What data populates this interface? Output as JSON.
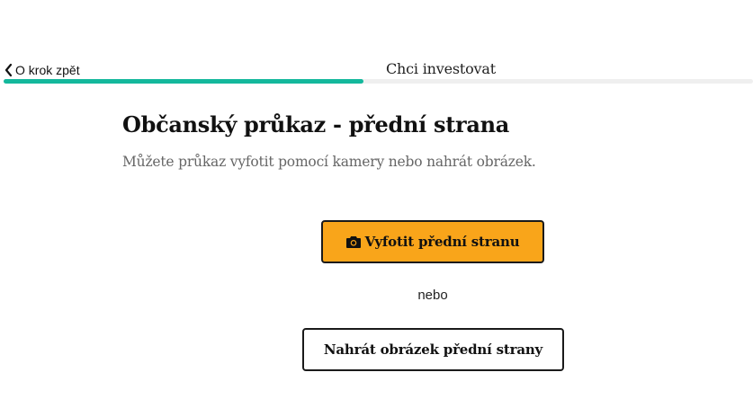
{
  "nav": {
    "back_label": "O krok zpět",
    "step_title": "Chci investovat"
  },
  "progress": {
    "fraction": 0.48,
    "fill_color": "#14b89c",
    "track_color": "#efefef"
  },
  "main": {
    "title": "Občanský průkaz - přední strana",
    "subtitle": "Můžete průkaz vyfotit pomocí kamery nebo nahrát obrázek.",
    "take_photo_label": "Vyfotit přední stranu",
    "take_photo_icon": "camera-icon",
    "or_label": "nebo",
    "upload_label": "Nahrát obrázek přední strany"
  },
  "colors": {
    "primary_button": "#f9a51a",
    "accent": "#14b89c"
  }
}
